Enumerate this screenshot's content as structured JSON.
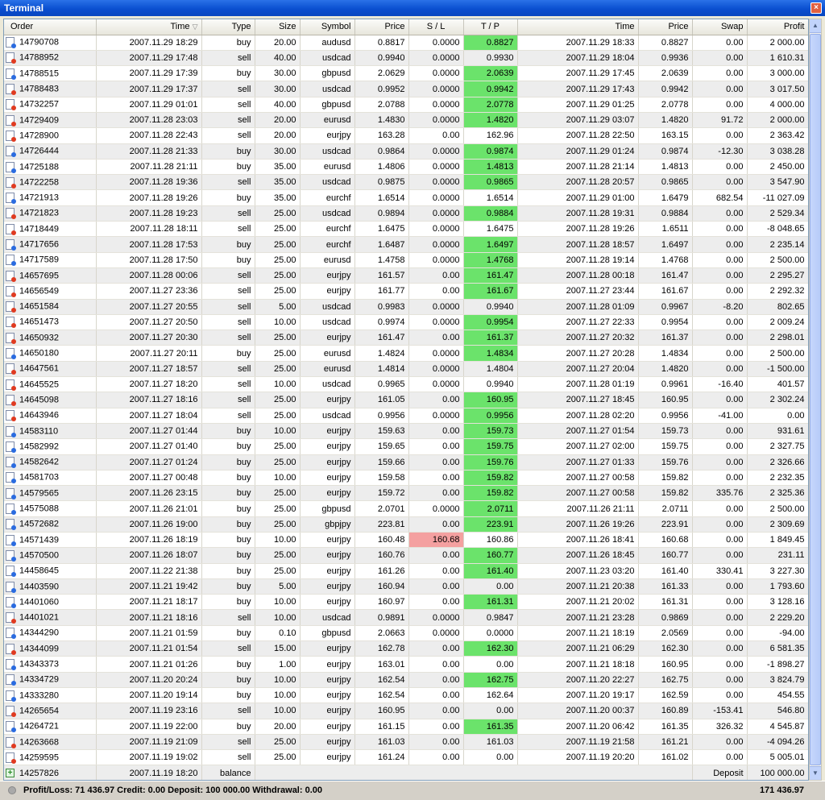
{
  "window": {
    "title": "Terminal"
  },
  "columns": [
    "Order",
    "Time",
    "Type",
    "Size",
    "Symbol",
    "Price",
    "S / L",
    "T / P",
    "Time",
    "Price",
    "Swap",
    "Profit"
  ],
  "rows": [
    {
      "order": "14790708",
      "open_time": "2007.11.29 18:29",
      "type": "buy",
      "size": "20.00",
      "symbol": "audusd",
      "price": "0.8817",
      "sl": "0.0000",
      "tp": "0.8827",
      "close_time": "2007.11.29 18:33",
      "close_price": "0.8827",
      "swap": "0.00",
      "profit": "2 000.00",
      "tp_hit": true
    },
    {
      "order": "14788952",
      "open_time": "2007.11.29 17:48",
      "type": "sell",
      "size": "40.00",
      "symbol": "usdcad",
      "price": "0.9940",
      "sl": "0.0000",
      "tp": "0.9930",
      "close_time": "2007.11.29 18:04",
      "close_price": "0.9936",
      "swap": "0.00",
      "profit": "1 610.31"
    },
    {
      "order": "14788515",
      "open_time": "2007.11.29 17:39",
      "type": "buy",
      "size": "30.00",
      "symbol": "gbpusd",
      "price": "2.0629",
      "sl": "0.0000",
      "tp": "2.0639",
      "close_time": "2007.11.29 17:45",
      "close_price": "2.0639",
      "swap": "0.00",
      "profit": "3 000.00",
      "tp_hit": true
    },
    {
      "order": "14788483",
      "open_time": "2007.11.29 17:37",
      "type": "sell",
      "size": "30.00",
      "symbol": "usdcad",
      "price": "0.9952",
      "sl": "0.0000",
      "tp": "0.9942",
      "close_time": "2007.11.29 17:43",
      "close_price": "0.9942",
      "swap": "0.00",
      "profit": "3 017.50",
      "tp_hit": true
    },
    {
      "order": "14732257",
      "open_time": "2007.11.29 01:01",
      "type": "sell",
      "size": "40.00",
      "symbol": "gbpusd",
      "price": "2.0788",
      "sl": "0.0000",
      "tp": "2.0778",
      "close_time": "2007.11.29 01:25",
      "close_price": "2.0778",
      "swap": "0.00",
      "profit": "4 000.00",
      "tp_hit": true
    },
    {
      "order": "14729409",
      "open_time": "2007.11.28 23:03",
      "type": "sell",
      "size": "20.00",
      "symbol": "eurusd",
      "price": "1.4830",
      "sl": "0.0000",
      "tp": "1.4820",
      "close_time": "2007.11.29 03:07",
      "close_price": "1.4820",
      "swap": "91.72",
      "profit": "2 000.00",
      "tp_hit": true
    },
    {
      "order": "14728900",
      "open_time": "2007.11.28 22:43",
      "type": "sell",
      "size": "20.00",
      "symbol": "eurjpy",
      "price": "163.28",
      "sl": "0.00",
      "tp": "162.96",
      "close_time": "2007.11.28 22:50",
      "close_price": "163.15",
      "swap": "0.00",
      "profit": "2 363.42"
    },
    {
      "order": "14726444",
      "open_time": "2007.11.28 21:33",
      "type": "buy",
      "size": "30.00",
      "symbol": "usdcad",
      "price": "0.9864",
      "sl": "0.0000",
      "tp": "0.9874",
      "close_time": "2007.11.29 01:24",
      "close_price": "0.9874",
      "swap": "-12.30",
      "profit": "3 038.28",
      "tp_hit": true
    },
    {
      "order": "14725188",
      "open_time": "2007.11.28 21:11",
      "type": "buy",
      "size": "35.00",
      "symbol": "eurusd",
      "price": "1.4806",
      "sl": "0.0000",
      "tp": "1.4813",
      "close_time": "2007.11.28 21:14",
      "close_price": "1.4813",
      "swap": "0.00",
      "profit": "2 450.00",
      "tp_hit": true
    },
    {
      "order": "14722258",
      "open_time": "2007.11.28 19:36",
      "type": "sell",
      "size": "35.00",
      "symbol": "usdcad",
      "price": "0.9875",
      "sl": "0.0000",
      "tp": "0.9865",
      "close_time": "2007.11.28 20:57",
      "close_price": "0.9865",
      "swap": "0.00",
      "profit": "3 547.90",
      "tp_hit": true
    },
    {
      "order": "14721913",
      "open_time": "2007.11.28 19:26",
      "type": "buy",
      "size": "35.00",
      "symbol": "eurchf",
      "price": "1.6514",
      "sl": "0.0000",
      "tp": "1.6514",
      "close_time": "2007.11.29 01:00",
      "close_price": "1.6479",
      "swap": "682.54",
      "profit": "-11 027.09"
    },
    {
      "order": "14721823",
      "open_time": "2007.11.28 19:23",
      "type": "sell",
      "size": "25.00",
      "symbol": "usdcad",
      "price": "0.9894",
      "sl": "0.0000",
      "tp": "0.9884",
      "close_time": "2007.11.28 19:31",
      "close_price": "0.9884",
      "swap": "0.00",
      "profit": "2 529.34",
      "tp_hit": true
    },
    {
      "order": "14718449",
      "open_time": "2007.11.28 18:11",
      "type": "sell",
      "size": "25.00",
      "symbol": "eurchf",
      "price": "1.6475",
      "sl": "0.0000",
      "tp": "1.6475",
      "close_time": "2007.11.28 19:26",
      "close_price": "1.6511",
      "swap": "0.00",
      "profit": "-8 048.65"
    },
    {
      "order": "14717656",
      "open_time": "2007.11.28 17:53",
      "type": "buy",
      "size": "25.00",
      "symbol": "eurchf",
      "price": "1.6487",
      "sl": "0.0000",
      "tp": "1.6497",
      "close_time": "2007.11.28 18:57",
      "close_price": "1.6497",
      "swap": "0.00",
      "profit": "2 235.14",
      "tp_hit": true
    },
    {
      "order": "14717589",
      "open_time": "2007.11.28 17:50",
      "type": "buy",
      "size": "25.00",
      "symbol": "eurusd",
      "price": "1.4758",
      "sl": "0.0000",
      "tp": "1.4768",
      "close_time": "2007.11.28 19:14",
      "close_price": "1.4768",
      "swap": "0.00",
      "profit": "2 500.00",
      "tp_hit": true
    },
    {
      "order": "14657695",
      "open_time": "2007.11.28 00:06",
      "type": "sell",
      "size": "25.00",
      "symbol": "eurjpy",
      "price": "161.57",
      "sl": "0.00",
      "tp": "161.47",
      "close_time": "2007.11.28 00:18",
      "close_price": "161.47",
      "swap": "0.00",
      "profit": "2 295.27",
      "tp_hit": true
    },
    {
      "order": "14656549",
      "open_time": "2007.11.27 23:36",
      "type": "sell",
      "size": "25.00",
      "symbol": "eurjpy",
      "price": "161.77",
      "sl": "0.00",
      "tp": "161.67",
      "close_time": "2007.11.27 23:44",
      "close_price": "161.67",
      "swap": "0.00",
      "profit": "2 292.32",
      "tp_hit": true
    },
    {
      "order": "14651584",
      "open_time": "2007.11.27 20:55",
      "type": "sell",
      "size": "5.00",
      "symbol": "usdcad",
      "price": "0.9983",
      "sl": "0.0000",
      "tp": "0.9940",
      "close_time": "2007.11.28 01:09",
      "close_price": "0.9967",
      "swap": "-8.20",
      "profit": "802.65"
    },
    {
      "order": "14651473",
      "open_time": "2007.11.27 20:50",
      "type": "sell",
      "size": "10.00",
      "symbol": "usdcad",
      "price": "0.9974",
      "sl": "0.0000",
      "tp": "0.9954",
      "close_time": "2007.11.27 22:33",
      "close_price": "0.9954",
      "swap": "0.00",
      "profit": "2 009.24",
      "tp_hit": true
    },
    {
      "order": "14650932",
      "open_time": "2007.11.27 20:30",
      "type": "sell",
      "size": "25.00",
      "symbol": "eurjpy",
      "price": "161.47",
      "sl": "0.00",
      "tp": "161.37",
      "close_time": "2007.11.27 20:32",
      "close_price": "161.37",
      "swap": "0.00",
      "profit": "2 298.01",
      "tp_hit": true
    },
    {
      "order": "14650180",
      "open_time": "2007.11.27 20:11",
      "type": "buy",
      "size": "25.00",
      "symbol": "eurusd",
      "price": "1.4824",
      "sl": "0.0000",
      "tp": "1.4834",
      "close_time": "2007.11.27 20:28",
      "close_price": "1.4834",
      "swap": "0.00",
      "profit": "2 500.00",
      "tp_hit": true
    },
    {
      "order": "14647561",
      "open_time": "2007.11.27 18:57",
      "type": "sell",
      "size": "25.00",
      "symbol": "eurusd",
      "price": "1.4814",
      "sl": "0.0000",
      "tp": "1.4804",
      "close_time": "2007.11.27 20:04",
      "close_price": "1.4820",
      "swap": "0.00",
      "profit": "-1 500.00"
    },
    {
      "order": "14645525",
      "open_time": "2007.11.27 18:20",
      "type": "sell",
      "size": "10.00",
      "symbol": "usdcad",
      "price": "0.9965",
      "sl": "0.0000",
      "tp": "0.9940",
      "close_time": "2007.11.28 01:19",
      "close_price": "0.9961",
      "swap": "-16.40",
      "profit": "401.57"
    },
    {
      "order": "14645098",
      "open_time": "2007.11.27 18:16",
      "type": "sell",
      "size": "25.00",
      "symbol": "eurjpy",
      "price": "161.05",
      "sl": "0.00",
      "tp": "160.95",
      "close_time": "2007.11.27 18:45",
      "close_price": "160.95",
      "swap": "0.00",
      "profit": "2 302.24",
      "tp_hit": true
    },
    {
      "order": "14643946",
      "open_time": "2007.11.27 18:04",
      "type": "sell",
      "size": "25.00",
      "symbol": "usdcad",
      "price": "0.9956",
      "sl": "0.0000",
      "tp": "0.9956",
      "close_time": "2007.11.28 02:20",
      "close_price": "0.9956",
      "swap": "-41.00",
      "profit": "0.00",
      "tp_hit": true
    },
    {
      "order": "14583110",
      "open_time": "2007.11.27 01:44",
      "type": "buy",
      "size": "10.00",
      "symbol": "eurjpy",
      "price": "159.63",
      "sl": "0.00",
      "tp": "159.73",
      "close_time": "2007.11.27 01:54",
      "close_price": "159.73",
      "swap": "0.00",
      "profit": "931.61",
      "tp_hit": true
    },
    {
      "order": "14582992",
      "open_time": "2007.11.27 01:40",
      "type": "buy",
      "size": "25.00",
      "symbol": "eurjpy",
      "price": "159.65",
      "sl": "0.00",
      "tp": "159.75",
      "close_time": "2007.11.27 02:00",
      "close_price": "159.75",
      "swap": "0.00",
      "profit": "2 327.75",
      "tp_hit": true
    },
    {
      "order": "14582642",
      "open_time": "2007.11.27 01:24",
      "type": "buy",
      "size": "25.00",
      "symbol": "eurjpy",
      "price": "159.66",
      "sl": "0.00",
      "tp": "159.76",
      "close_time": "2007.11.27 01:33",
      "close_price": "159.76",
      "swap": "0.00",
      "profit": "2 326.66",
      "tp_hit": true
    },
    {
      "order": "14581703",
      "open_time": "2007.11.27 00:48",
      "type": "buy",
      "size": "10.00",
      "symbol": "eurjpy",
      "price": "159.58",
      "sl": "0.00",
      "tp": "159.82",
      "close_time": "2007.11.27 00:58",
      "close_price": "159.82",
      "swap": "0.00",
      "profit": "2 232.35",
      "tp_hit": true
    },
    {
      "order": "14579565",
      "open_time": "2007.11.26 23:15",
      "type": "buy",
      "size": "25.00",
      "symbol": "eurjpy",
      "price": "159.72",
      "sl": "0.00",
      "tp": "159.82",
      "close_time": "2007.11.27 00:58",
      "close_price": "159.82",
      "swap": "335.76",
      "profit": "2 325.36",
      "tp_hit": true
    },
    {
      "order": "14575088",
      "open_time": "2007.11.26 21:01",
      "type": "buy",
      "size": "25.00",
      "symbol": "gbpusd",
      "price": "2.0701",
      "sl": "0.0000",
      "tp": "2.0711",
      "close_time": "2007.11.26 21:11",
      "close_price": "2.0711",
      "swap": "0.00",
      "profit": "2 500.00",
      "tp_hit": true
    },
    {
      "order": "14572682",
      "open_time": "2007.11.26 19:00",
      "type": "buy",
      "size": "25.00",
      "symbol": "gbpjpy",
      "price": "223.81",
      "sl": "0.00",
      "tp": "223.91",
      "close_time": "2007.11.26 19:26",
      "close_price": "223.91",
      "swap": "0.00",
      "profit": "2 309.69",
      "tp_hit": true
    },
    {
      "order": "14571439",
      "open_time": "2007.11.26 18:19",
      "type": "buy",
      "size": "10.00",
      "symbol": "eurjpy",
      "price": "160.48",
      "sl": "160.68",
      "tp": "160.86",
      "close_time": "2007.11.26 18:41",
      "close_price": "160.68",
      "swap": "0.00",
      "profit": "1 849.45",
      "sl_hit": true
    },
    {
      "order": "14570500",
      "open_time": "2007.11.26 18:07",
      "type": "buy",
      "size": "25.00",
      "symbol": "eurjpy",
      "price": "160.76",
      "sl": "0.00",
      "tp": "160.77",
      "close_time": "2007.11.26 18:45",
      "close_price": "160.77",
      "swap": "0.00",
      "profit": "231.11",
      "tp_hit": true
    },
    {
      "order": "14458645",
      "open_time": "2007.11.22 21:38",
      "type": "buy",
      "size": "25.00",
      "symbol": "eurjpy",
      "price": "161.26",
      "sl": "0.00",
      "tp": "161.40",
      "close_time": "2007.11.23 03:20",
      "close_price": "161.40",
      "swap": "330.41",
      "profit": "3 227.30",
      "tp_hit": true
    },
    {
      "order": "14403590",
      "open_time": "2007.11.21 19:42",
      "type": "buy",
      "size": "5.00",
      "symbol": "eurjpy",
      "price": "160.94",
      "sl": "0.00",
      "tp": "0.00",
      "close_time": "2007.11.21 20:38",
      "close_price": "161.33",
      "swap": "0.00",
      "profit": "1 793.60"
    },
    {
      "order": "14401060",
      "open_time": "2007.11.21 18:17",
      "type": "buy",
      "size": "10.00",
      "symbol": "eurjpy",
      "price": "160.97",
      "sl": "0.00",
      "tp": "161.31",
      "close_time": "2007.11.21 20:02",
      "close_price": "161.31",
      "swap": "0.00",
      "profit": "3 128.16",
      "tp_hit": true
    },
    {
      "order": "14401021",
      "open_time": "2007.11.21 18:16",
      "type": "sell",
      "size": "10.00",
      "symbol": "usdcad",
      "price": "0.9891",
      "sl": "0.0000",
      "tp": "0.9847",
      "close_time": "2007.11.21 23:28",
      "close_price": "0.9869",
      "swap": "0.00",
      "profit": "2 229.20"
    },
    {
      "order": "14344290",
      "open_time": "2007.11.21 01:59",
      "type": "buy",
      "size": "0.10",
      "symbol": "gbpusd",
      "price": "2.0663",
      "sl": "0.0000",
      "tp": "0.0000",
      "close_time": "2007.11.21 18:19",
      "close_price": "2.0569",
      "swap": "0.00",
      "profit": "-94.00"
    },
    {
      "order": "14344099",
      "open_time": "2007.11.21 01:54",
      "type": "sell",
      "size": "15.00",
      "symbol": "eurjpy",
      "price": "162.78",
      "sl": "0.00",
      "tp": "162.30",
      "close_time": "2007.11.21 06:29",
      "close_price": "162.30",
      "swap": "0.00",
      "profit": "6 581.35",
      "tp_hit": true
    },
    {
      "order": "14343373",
      "open_time": "2007.11.21 01:26",
      "type": "buy",
      "size": "1.00",
      "symbol": "eurjpy",
      "price": "163.01",
      "sl": "0.00",
      "tp": "0.00",
      "close_time": "2007.11.21 18:18",
      "close_price": "160.95",
      "swap": "0.00",
      "profit": "-1 898.27"
    },
    {
      "order": "14334729",
      "open_time": "2007.11.20 20:24",
      "type": "buy",
      "size": "10.00",
      "symbol": "eurjpy",
      "price": "162.54",
      "sl": "0.00",
      "tp": "162.75",
      "close_time": "2007.11.20 22:27",
      "close_price": "162.75",
      "swap": "0.00",
      "profit": "3 824.79",
      "tp_hit": true
    },
    {
      "order": "14333280",
      "open_time": "2007.11.20 19:14",
      "type": "buy",
      "size": "10.00",
      "symbol": "eurjpy",
      "price": "162.54",
      "sl": "0.00",
      "tp": "162.64",
      "close_time": "2007.11.20 19:17",
      "close_price": "162.59",
      "swap": "0.00",
      "profit": "454.55"
    },
    {
      "order": "14265654",
      "open_time": "2007.11.19 23:16",
      "type": "sell",
      "size": "10.00",
      "symbol": "eurjpy",
      "price": "160.95",
      "sl": "0.00",
      "tp": "0.00",
      "close_time": "2007.11.20 00:37",
      "close_price": "160.89",
      "swap": "-153.41",
      "profit": "546.80"
    },
    {
      "order": "14264721",
      "open_time": "2007.11.19 22:00",
      "type": "buy",
      "size": "20.00",
      "symbol": "eurjpy",
      "price": "161.15",
      "sl": "0.00",
      "tp": "161.35",
      "close_time": "2007.11.20 06:42",
      "close_price": "161.35",
      "swap": "326.32",
      "profit": "4 545.87",
      "tp_hit": true
    },
    {
      "order": "14263668",
      "open_time": "2007.11.19 21:09",
      "type": "sell",
      "size": "25.00",
      "symbol": "eurjpy",
      "price": "161.03",
      "sl": "0.00",
      "tp": "161.03",
      "close_time": "2007.11.19 21:58",
      "close_price": "161.21",
      "swap": "0.00",
      "profit": "-4 094.26"
    },
    {
      "order": "14259595",
      "open_time": "2007.11.19 19:02",
      "type": "sell",
      "size": "25.00",
      "symbol": "eurjpy",
      "price": "161.24",
      "sl": "0.00",
      "tp": "0.00",
      "close_time": "2007.11.19 20:20",
      "close_price": "161.02",
      "swap": "0.00",
      "profit": "5 005.01"
    }
  ],
  "balance_row": {
    "order": "14257826",
    "open_time": "2007.11.19 18:20",
    "type": "balance",
    "comment": "Deposit",
    "profit": "100 000.00"
  },
  "status": {
    "summary": "Profit/Loss: 71 436.97  Credit: 0.00  Deposit: 100 000.00  Withdrawal: 0.00",
    "total": "171 436.97"
  },
  "colors": {
    "tp_hit": "#6be36b",
    "sl_hit": "#f4a0a0",
    "title_bar": "#0a4fd0"
  },
  "icons": {
    "buy": "ticket-buy-icon",
    "sell": "ticket-sell-icon",
    "balance": "balance-icon",
    "close": "close-icon"
  }
}
